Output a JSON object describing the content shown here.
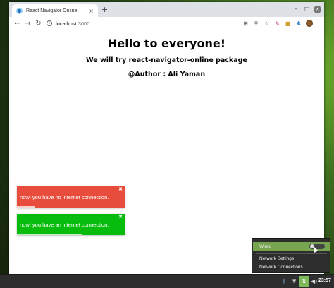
{
  "browser": {
    "tab_title": "React Navigator Online",
    "tab_close": "×",
    "new_tab": "+",
    "window_controls": {
      "minimize": "–",
      "maximize": "□",
      "close": "×"
    },
    "address": {
      "host": "localhost",
      "port": ":3000"
    },
    "icons": [
      "back-icon",
      "forward-icon",
      "reload-icon",
      "info-icon",
      "translate-icon",
      "zoom-icon",
      "star-icon",
      "pen-icon",
      "extension-icon",
      "puzzle-icon",
      "avatar"
    ]
  },
  "page": {
    "title": "Hello to everyone!",
    "subtitle": "We will try react-navigator-online package",
    "author": "@Author : Ali Yaman"
  },
  "toasts": [
    {
      "message": "now! you have no internet connection.",
      "color": "#e74c3c",
      "close": "✖",
      "progress": 0.17
    },
    {
      "message": "now! you have an internet connection.",
      "color": "#07bc0c",
      "close": "✖",
      "progress": 0.6
    }
  ],
  "network_popup": {
    "wired_label": "Wired",
    "settings_label": "Network Settings",
    "connections_label": "Network Connections"
  },
  "taskbar": {
    "clock": "23:57"
  }
}
